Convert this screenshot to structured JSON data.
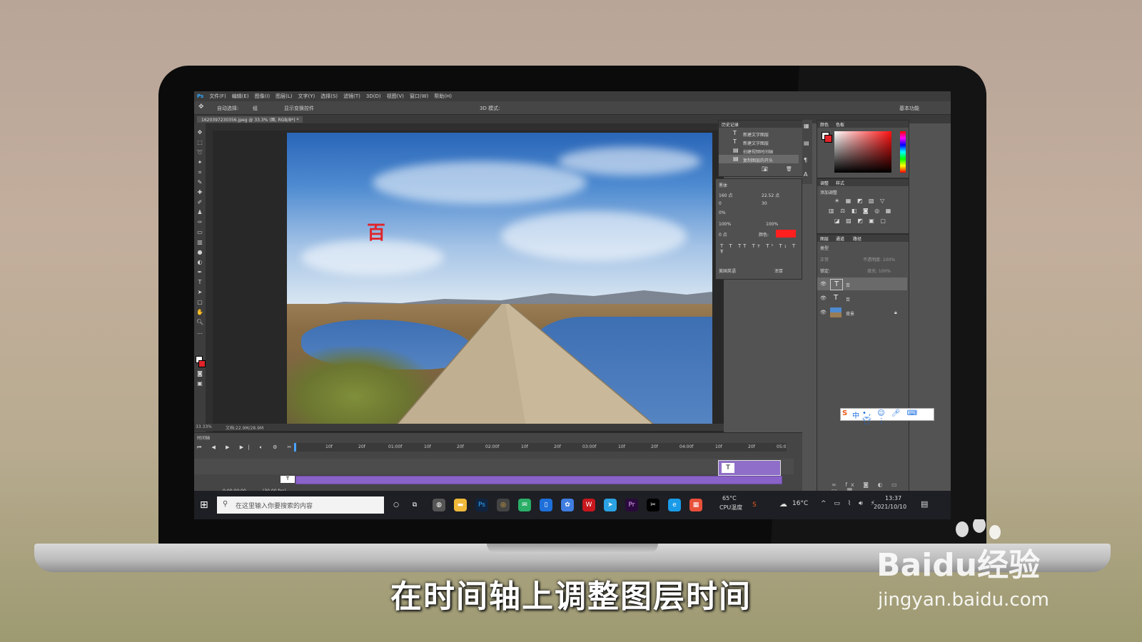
{
  "menubar": {
    "logo": "Ps",
    "items": [
      "文件(F)",
      "编辑(E)",
      "图像(I)",
      "图层(L)",
      "文字(Y)",
      "选择(S)",
      "滤镜(T)",
      "3D(D)",
      "视图(V)",
      "窗口(W)",
      "帮助(H)"
    ]
  },
  "options": {
    "auto_select": "自动选择:",
    "group": "组",
    "show_transform": "显示变换控件",
    "mode_3d": "3D 模式:",
    "workspace": "基本功能"
  },
  "document": {
    "tab": "1620397230356.jpeg @ 33.3% (图, RGB/8*) *",
    "zoom": "33.33%",
    "doc_size": "文档:22.9M/28.9M",
    "char_on_canvas": "百"
  },
  "history": {
    "title": "历史记录",
    "items": [
      "新建文字图层",
      "新建文字图层",
      "创建视频时间轴",
      "复制图层的开头"
    ]
  },
  "character": {
    "font": "黑体",
    "size": "160 点",
    "leading": "22.52 点",
    "kerning": "0",
    "tracking": "30",
    "scale_pct": "0%",
    "v_scale": "100%",
    "h_scale": "100%",
    "baseline": "0 点",
    "color_label": "颜色:",
    "language": "美国英语",
    "aa": "浑厚"
  },
  "color_panel": {
    "tab1": "颜色",
    "tab2": "色板"
  },
  "adjust_panel": {
    "tab1": "调整",
    "tab2": "样式",
    "add": "添加调整"
  },
  "layers_panel": {
    "tab1": "图层",
    "tab2": "通道",
    "tab3": "路径",
    "kind": "类型",
    "blend": "正常",
    "opacity": "不透明度: 100%",
    "lock": "锁定:",
    "fill": "填充: 100%",
    "layers": [
      {
        "name": "百",
        "thumb": "T"
      },
      {
        "name": "百",
        "thumb": "T"
      },
      {
        "name": "背景",
        "thumb": ""
      }
    ]
  },
  "ime": {
    "label": "中"
  },
  "timeline": {
    "title": "时间轴",
    "ticks": [
      "10f",
      "20f",
      "01:00f",
      "10f",
      "20f",
      "02:00f",
      "10f",
      "20f",
      "03:00f",
      "10f",
      "20f",
      "04:00f",
      "10f",
      "20f",
      "05:0"
    ],
    "time": "0:00:00:00",
    "fps": "(30.00 fps)",
    "clip_label": "T"
  },
  "taskbar": {
    "search_placeholder": "在这里输入你要搜索的内容",
    "cpu_temp": "65°C",
    "cpu_label": "CPU温度",
    "weather": "16°C",
    "time": "13:37",
    "date": "2021/10/10"
  },
  "caption": "在时间轴上调整图层时间",
  "watermark": {
    "logo": "Baidu经验",
    "url": "jingyan.baidu.com"
  },
  "colors": {
    "ps_bg": "#535353",
    "text_red": "#e0242a",
    "clip_purple": "#8a63c8"
  }
}
